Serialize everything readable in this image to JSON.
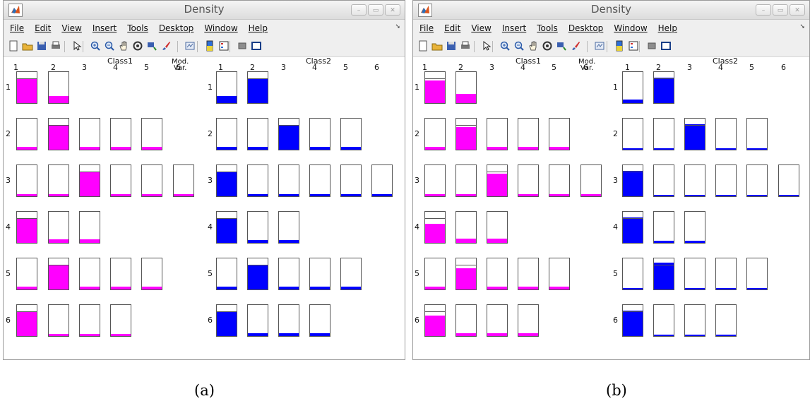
{
  "windows": [
    {
      "title": "Density",
      "menu": [
        "File",
        "Edit",
        "View",
        "Insert",
        "Tools",
        "Desktop",
        "Window",
        "Help"
      ],
      "toolbar_icons": [
        "new-figure-icon",
        "open-file-icon",
        "save-icon",
        "print-icon",
        "pointer-icon",
        "zoom-in-icon",
        "zoom-out-icon",
        "pan-icon",
        "rotate-3d-icon",
        "data-cursor-icon",
        "brush-icon",
        "link-plot-icon",
        "colorbar-icon",
        "legend-icon",
        "hide-plot-tools-icon",
        "show-plot-tools-icon"
      ],
      "column_labels": [
        "1",
        "2",
        "3",
        "4",
        "5",
        "6"
      ],
      "mod_var_label": [
        "Mod.",
        "Var."
      ],
      "panels": [
        {
          "class_label": "Class1",
          "color": "#ff00ff",
          "rows": [
            {
              "label": "1",
              "levels": [
                0.78,
                0.22
              ]
            },
            {
              "label": "2",
              "levels": [
                0.08,
                0.8,
                0.08,
                0.08,
                0.08
              ]
            },
            {
              "label": "3",
              "levels": [
                0.06,
                0.06,
                0.78,
                0.06,
                0.06,
                0.06
              ]
            },
            {
              "label": "4",
              "levels": [
                0.78,
                0.12,
                0.12
              ]
            },
            {
              "label": "5",
              "levels": [
                0.08,
                0.78,
                0.08,
                0.08,
                0.08
              ]
            },
            {
              "label": "6",
              "levels": [
                0.78,
                0.06,
                0.06,
                0.06
              ]
            }
          ]
        },
        {
          "class_label": "Class2",
          "color": "#0000ff",
          "rows": [
            {
              "label": "1",
              "levels": [
                0.22,
                0.78
              ]
            },
            {
              "label": "2",
              "levels": [
                0.08,
                0.08,
                0.78,
                0.08,
                0.08
              ]
            },
            {
              "label": "3",
              "levels": [
                0.78,
                0.06,
                0.06,
                0.06,
                0.06,
                0.06
              ]
            },
            {
              "label": "4",
              "levels": [
                0.78,
                0.1,
                0.1
              ]
            },
            {
              "label": "5",
              "levels": [
                0.08,
                0.78,
                0.08,
                0.08,
                0.08
              ]
            },
            {
              "label": "6",
              "levels": [
                0.78,
                0.08,
                0.08,
                0.08
              ]
            }
          ]
        }
      ],
      "caption": "(a)"
    },
    {
      "title": "Density",
      "menu": [
        "File",
        "Edit",
        "View",
        "Insert",
        "Tools",
        "Desktop",
        "Window",
        "Help"
      ],
      "toolbar_icons": [
        "new-figure-icon",
        "open-file-icon",
        "save-icon",
        "print-icon",
        "pointer-icon",
        "zoom-in-icon",
        "zoom-out-icon",
        "pan-icon",
        "rotate-3d-icon",
        "data-cursor-icon",
        "brush-icon",
        "link-plot-icon",
        "colorbar-icon",
        "legend-icon",
        "hide-plot-tools-icon",
        "show-plot-tools-icon"
      ],
      "column_labels": [
        "1",
        "2",
        "3",
        "4",
        "5",
        "6"
      ],
      "mod_var_label": [
        "Mod.",
        "Var."
      ],
      "panels": [
        {
          "class_label": "Class1",
          "color": "#ff00ff",
          "rows": [
            {
              "label": "1",
              "levels": [
                0.72,
                0.3
              ]
            },
            {
              "label": "2",
              "levels": [
                0.08,
                0.72,
                0.08,
                0.08,
                0.08
              ]
            },
            {
              "label": "3",
              "levels": [
                0.06,
                0.06,
                0.72,
                0.06,
                0.06,
                0.06
              ]
            },
            {
              "label": "4",
              "levels": [
                0.62,
                0.14,
                0.14
              ]
            },
            {
              "label": "5",
              "levels": [
                0.08,
                0.68,
                0.08,
                0.08,
                0.08
              ]
            },
            {
              "label": "6",
              "levels": [
                0.65,
                0.1,
                0.1,
                0.1
              ]
            }
          ]
        },
        {
          "class_label": "Class2",
          "color": "#0000ff",
          "rows": [
            {
              "label": "1",
              "levels": [
                0.12,
                0.82
              ]
            },
            {
              "label": "2",
              "levels": [
                0.04,
                0.04,
                0.82,
                0.04,
                0.04
              ]
            },
            {
              "label": "3",
              "levels": [
                0.82,
                0.04,
                0.04,
                0.04,
                0.04,
                0.04
              ]
            },
            {
              "label": "4",
              "levels": [
                0.82,
                0.06,
                0.06
              ]
            },
            {
              "label": "5",
              "levels": [
                0.04,
                0.86,
                0.04,
                0.04,
                0.04
              ]
            },
            {
              "label": "6",
              "levels": [
                0.82,
                0.04,
                0.04,
                0.04
              ]
            }
          ]
        }
      ],
      "caption": "(b)"
    }
  ]
}
